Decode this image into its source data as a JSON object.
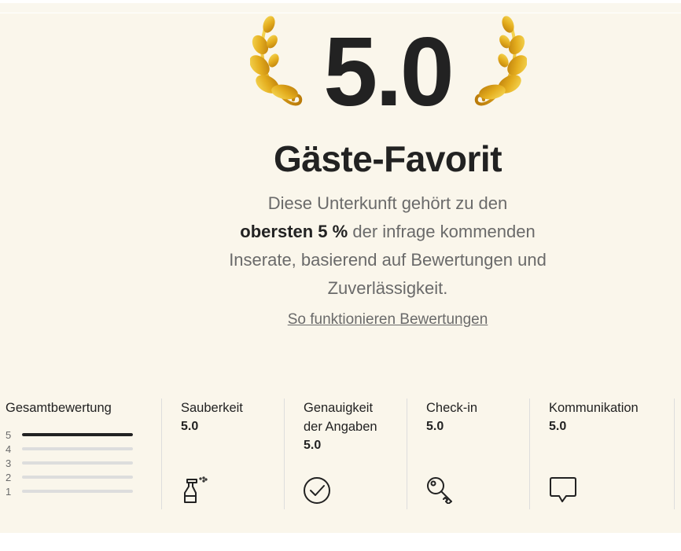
{
  "hero": {
    "rating": "5.0",
    "title": "Gäste-Favorit",
    "description_pre": "Diese Unterkunft gehört zu den",
    "description_bold": "obersten 5 %",
    "description_post": "der infrage kommenden Inserate, basierend auf Bewertungen und Zuverlässigkeit.",
    "link": "So funktionieren Bewertungen"
  },
  "overall": {
    "label": "Gesamtbewertung",
    "rows": [
      {
        "star": "5",
        "fraction": 1.0
      },
      {
        "star": "4",
        "fraction": 0
      },
      {
        "star": "3",
        "fraction": 0
      },
      {
        "star": "2",
        "fraction": 0
      },
      {
        "star": "1",
        "fraction": 0
      }
    ]
  },
  "categories": [
    {
      "name": "Sauberkeit",
      "value": "5.0",
      "icon": "spray-bottle-icon"
    },
    {
      "name": "Genauigkeit der Angaben",
      "value": "5.0",
      "icon": "check-circle-icon"
    },
    {
      "name": "Check-in",
      "value": "5.0",
      "icon": "key-icon"
    },
    {
      "name": "Kommunikation",
      "value": "5.0",
      "icon": "chat-bubble-icon"
    }
  ],
  "colors": {
    "background": "#faf6eb",
    "text": "#222222",
    "muted": "#6a6a6a",
    "laurel_gold": "#e2a818"
  }
}
